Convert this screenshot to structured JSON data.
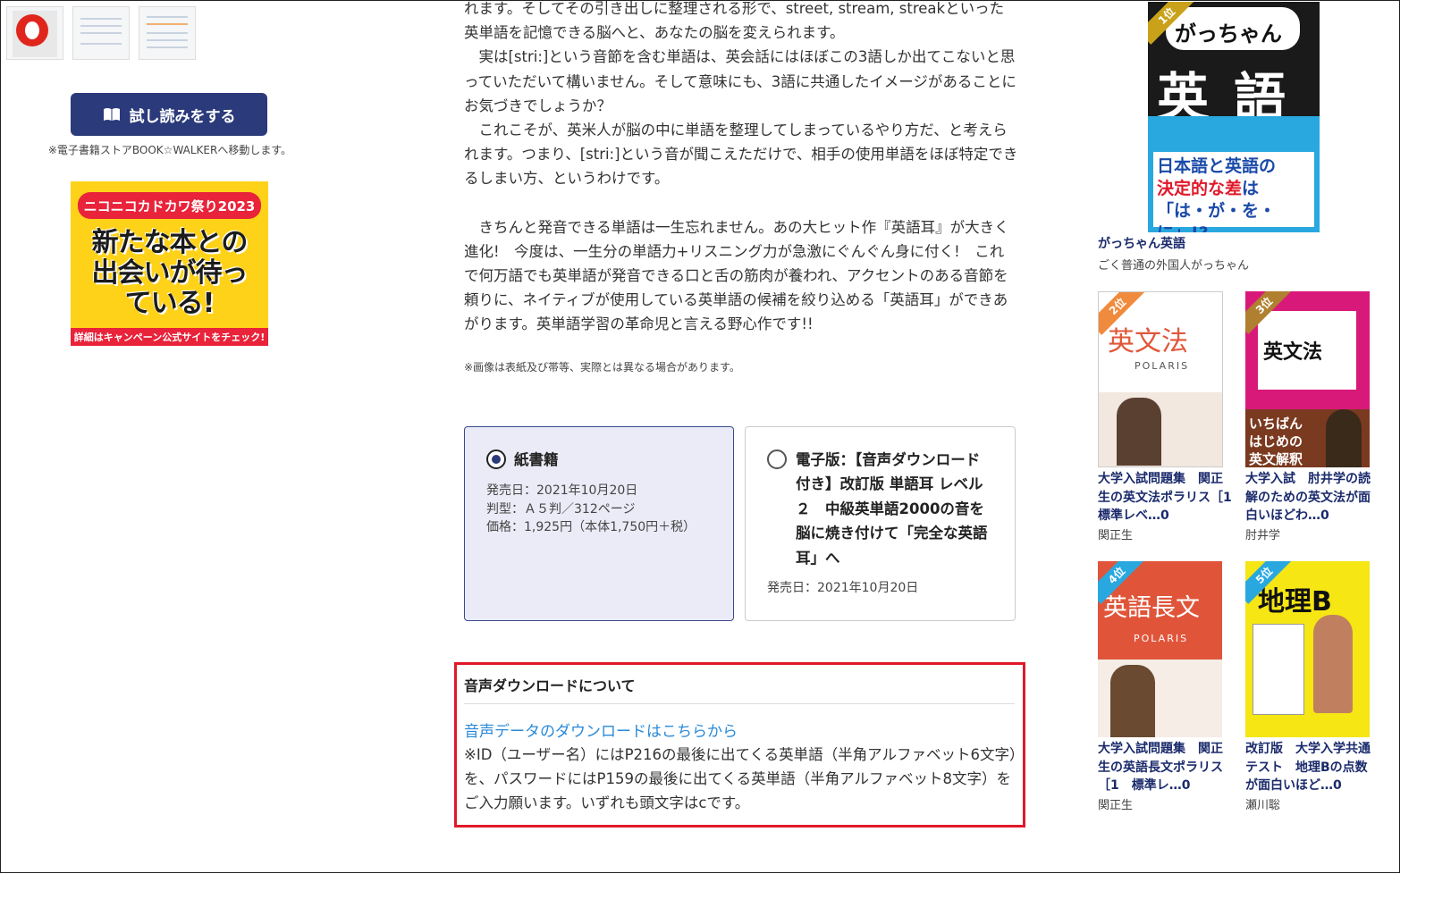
{
  "left": {
    "trial_button": "試し読みをする",
    "trial_note": "※電子書籍ストアBOOK☆WALKERへ移動します。",
    "banner": {
      "top": "ニコニコカドカワ祭り2023",
      "main": "新たな本との出会いが待っている!",
      "bottom": "詳細はキャンペーン公式サイトをチェック!"
    }
  },
  "main": {
    "paragraphs": [
      "れます。そしてその引き出しに整理される形で、street, stream, streakといった英単語を記憶できる脳へと、あなたの脳を変えられます。",
      "　実は[stri:]という音節を含む単語は、英会話にはほぼこの3語しか出てこないと思っていただいて構いません。そして意味にも、3語に共通したイメージがあることにお気づきでしょうか？",
      "　これこそが、英米人が脳の中に単語を整理してしまっているやり方だ、と考えられます。つまり、[stri:]という音が聞こえただけで、相手の使用単語をほぼ特定できるしまい方、というわけです。",
      "　きちんと発音できる単語は一生忘れません。あの大ヒット作『英語耳』が大きく進化!　今度は、一生分の単語力+リスニング力が急激にぐんぐん身に付く!　これで何万語でも英単語が発音できる口と舌の筋肉が養われ、アクセントのある音節を頼りに、ネイティブが使用している英単語の候補を絞り込める「英語耳」ができあがります。英単語学習の革命児と言える野心作です!!"
    ],
    "caption": "※画像は表紙及び帯等、実際とは異なる場合があります。",
    "formats": [
      {
        "title": "紙書籍",
        "release": "発売日：2021年10月20日",
        "format": "判型：Ａ５判／312ページ",
        "price": "価格：1,925円（本体1,750円＋税）"
      },
      {
        "title": "電子版：【音声ダウンロード付き】改訂版 単語耳 レベル２　中級英単語2000の音を脳に焼き付けて「完全な英語耳」へ",
        "release": "発売日：2021年10月20日"
      }
    ],
    "download": {
      "title": "音声ダウンロードについて",
      "link": "音声データのダウンロードはこちらから",
      "note": "※ID（ユーザー名）にはP216の最後に出てくる英単語（半角アルファベット6文字）を、パスワードにはP159の最後に出てくる英単語（半角アルファベット8文字）をご入力願います。いずれも頭文字はcです。"
    }
  },
  "ranking": [
    {
      "rank": "1位",
      "cover_text": "がっちゃん 英語",
      "title": "がっちゃん英語",
      "author": "ごく普通の外国人がっちゃん",
      "color": "#1a1a1a"
    },
    {
      "rank": "2位",
      "cover_text": "英文法",
      "title": "大学入試問題集　関正生の英文法ポラリス［1　標準レベ…0",
      "author": "関正生",
      "color": "#f08a3c"
    },
    {
      "rank": "3位",
      "cover_text": "英文法",
      "title": "大学入試　肘井学の読解のための英文法が面白いほどわ…0",
      "author": "肘井学",
      "color": "#d9197a"
    },
    {
      "rank": "4位",
      "cover_text": "英語長文",
      "title": "大学入試問題集　関正生の英語長文ポラリス［1　標準レ…0",
      "author": "関正生",
      "color": "#f08a3c"
    },
    {
      "rank": "5位",
      "cover_text": "地理B",
      "title": "改訂版　大学入学共通テスト　地理Bの点数が面白いほど…0",
      "author": "瀬川聡",
      "color": "#f5e614"
    }
  ]
}
